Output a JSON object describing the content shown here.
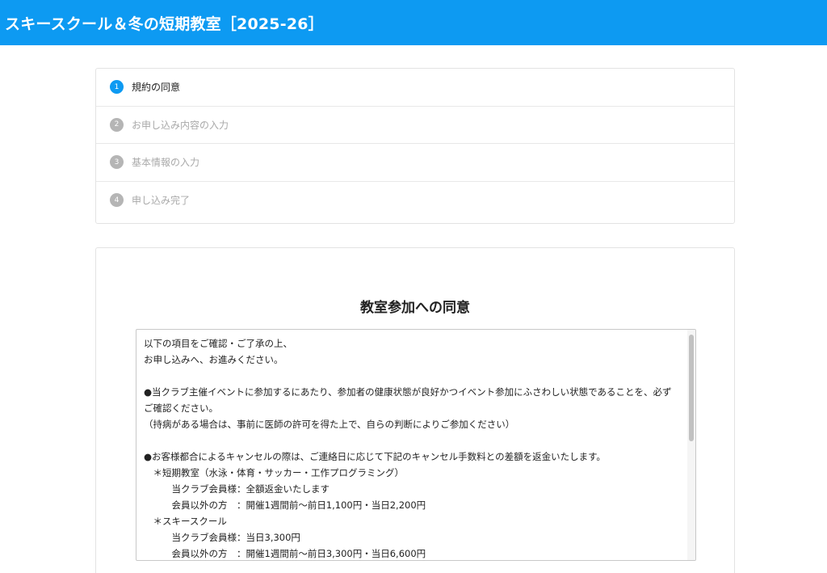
{
  "header": {
    "title": "スキースクール＆冬の短期教室［2025-26］"
  },
  "steps": [
    {
      "num": "1",
      "label": "規約の同意",
      "active": true
    },
    {
      "num": "2",
      "label": "お申し込み内容の入力",
      "active": false
    },
    {
      "num": "3",
      "label": "基本情報の入力",
      "active": false
    },
    {
      "num": "4",
      "label": "申し込み完了",
      "active": false
    }
  ],
  "consent": {
    "title": "教室参加への同意",
    "terms_text": "以下の項目をご確認・ご了承の上、\nお申し込みへ、お進みください。\n\n●当クラブ主催イベントに参加するにあたり、参加者の健康状態が良好かつイベント参加にふさわしい状態であることを、必ずご確認ください。\n（持病がある場合は、事前に医師の許可を得た上で、自らの判断によりご参加ください）\n\n●お客様都合によるキャンセルの際は、ご連絡日に応じて下記のキャンセル手数料との差額を返金いたします。\n　＊短期教室（水泳・体育・サッカー・工作プログラミング）\n　　　当クラブ会員様：全額返金いたします\n　　　会員以外の方　：開催1週間前～前日1,100円・当日2,200円\n　＊スキースクール\n　　　当クラブ会員様：当日3,300円\n　　　会員以外の方　：開催1週間前～前日3,300円・当日6,600円"
  },
  "colors": {
    "accent": "#0d9af2",
    "inactive_step": "#b5b5b5"
  }
}
